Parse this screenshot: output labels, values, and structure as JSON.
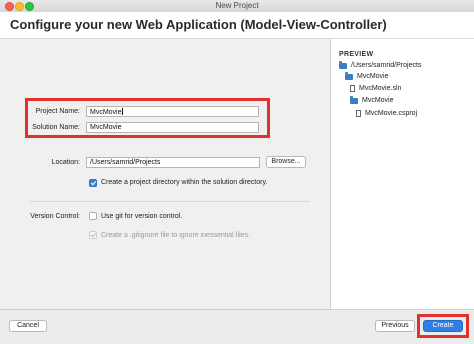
{
  "window": {
    "title": "New Project"
  },
  "header": {
    "title": "Configure your new Web Application (Model-View-Controller)"
  },
  "form": {
    "project_name_label": "Project Name:",
    "project_name_value": "MvcMovie",
    "solution_name_label": "Solution Name:",
    "solution_name_value": "MvcMovie",
    "location_label": "Location:",
    "location_value": "/Users/samrid/Projects",
    "browse_label": "Browse...",
    "create_dir_label": "Create a project directory within the solution directory.",
    "version_control_label": "Version Control:",
    "use_git_label": "Use git for version control.",
    "gitignore_label": "Create a .gitignore file to ignore inessential files."
  },
  "preview": {
    "title": "PREVIEW",
    "items": [
      {
        "label": "/Users/samrid/Projects",
        "icon": "folder-icon"
      },
      {
        "label": "MvcMovie",
        "icon": "folder-icon"
      },
      {
        "label": "MvcMovie.sln",
        "icon": "file-icon"
      },
      {
        "label": "MvcMovie",
        "icon": "folder-icon"
      },
      {
        "label": "MvcMovie.csproj",
        "icon": "file-icon"
      }
    ]
  },
  "footer": {
    "cancel_label": "Cancel",
    "previous_label": "Previous",
    "create_label": "Create"
  },
  "colors": {
    "highlight": "#e0322b",
    "accent": "#2f7fe6",
    "folder": "#3f7dc2"
  }
}
